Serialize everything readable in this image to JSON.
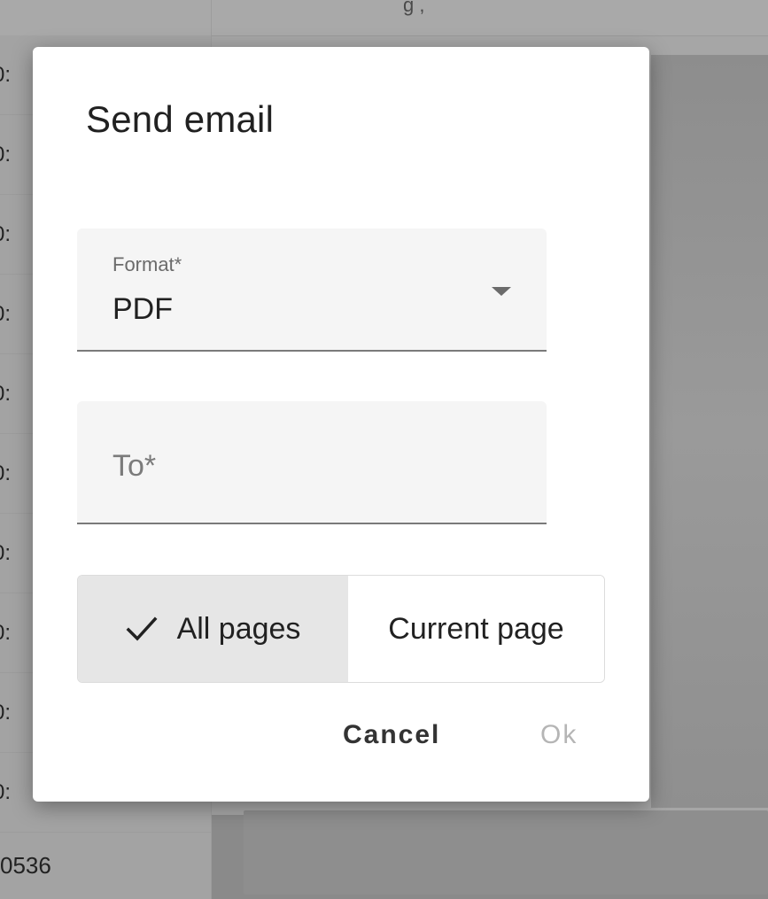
{
  "background": {
    "header_text": "g ,",
    "row_text": "0536",
    "partial_row_text": "0:"
  },
  "dialog": {
    "title": "Send email",
    "format_field": {
      "label": "Format*",
      "value": "PDF"
    },
    "to_field": {
      "placeholder": "To*"
    },
    "page_toggle": {
      "all_pages_label": "All pages",
      "current_page_label": "Current page",
      "selected": "All pages"
    },
    "actions": {
      "cancel_label": "Cancel",
      "ok_label": "Ok"
    }
  }
}
